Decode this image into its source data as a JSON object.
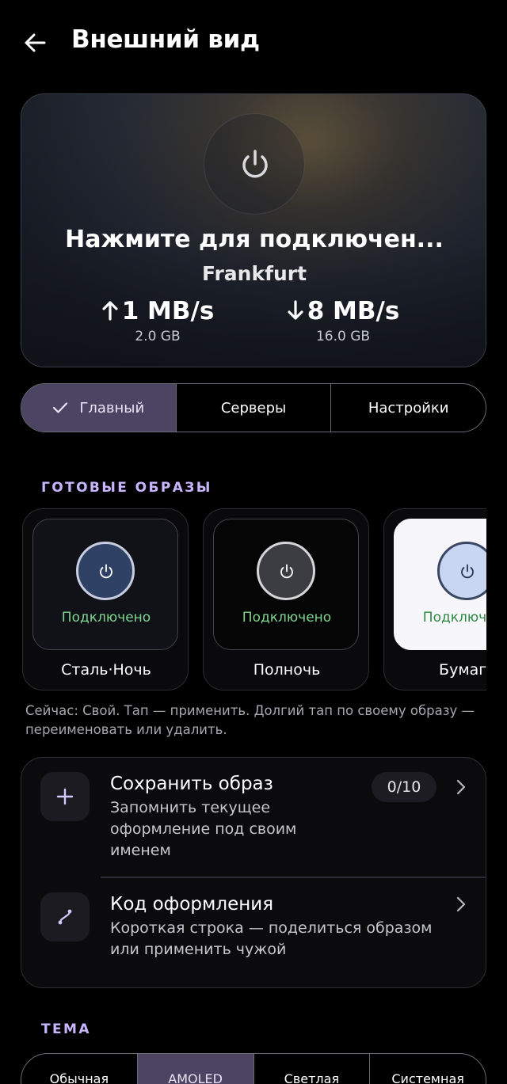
{
  "header": {
    "title": "Внешний вид",
    "back_icon": "arrow-left-icon"
  },
  "hero": {
    "status": "Нажмите для подключен...",
    "location": "Frankfurt",
    "upload": {
      "speed": "1 MB/s",
      "total": "2.0 GB"
    },
    "download": {
      "speed": "8 MB/s",
      "total": "16.0 GB"
    }
  },
  "nav_tabs": [
    {
      "label": "Главный",
      "active": true
    },
    {
      "label": "Серверы",
      "active": false
    },
    {
      "label": "Настройки",
      "active": false
    }
  ],
  "presets_section": {
    "label": "ГОТОВЫЕ ОБРАЗЫ",
    "items": [
      {
        "name": "Сталь·Ночь",
        "status": "Подключено",
        "colors": {
          "tile": "#101218",
          "circle": "#2f4266",
          "border": "#c8cde0"
        }
      },
      {
        "name": "Полночь",
        "status": "Подключено",
        "colors": {
          "tile": "#050506",
          "circle": "#3c3d42",
          "border": "#d6d6da"
        }
      },
      {
        "name": "Бумага",
        "status": "Подключено",
        "colors": {
          "tile": "#f6f6fb",
          "circle": "#c9d6f1",
          "border": "#3a4662",
          "text": "#2e8a42"
        }
      }
    ]
  },
  "hint": "Сейчас: Свой. Тап — применить. Долгий тап по своему образу — переименовать или удалить.",
  "actions": [
    {
      "title": "Сохранить образ",
      "description": "Запомнить текущее оформление под своим именем",
      "badge": "0/10",
      "icon": "plus-icon"
    },
    {
      "title": "Код оформления",
      "description": "Короткая строка — поделиться образом или применить чужой",
      "icon": "route-icon"
    }
  ],
  "theme_section": {
    "label": "ТЕМА",
    "options": [
      {
        "label": "Обычная",
        "active": false
      },
      {
        "label": "AMOLED",
        "active": true
      },
      {
        "label": "Светлая",
        "active": false
      },
      {
        "label": "Системная",
        "active": false
      }
    ]
  },
  "colors": {
    "accent": "#c7b6ff",
    "active_tab": "#4c4463",
    "connected": "#7fd48f"
  }
}
